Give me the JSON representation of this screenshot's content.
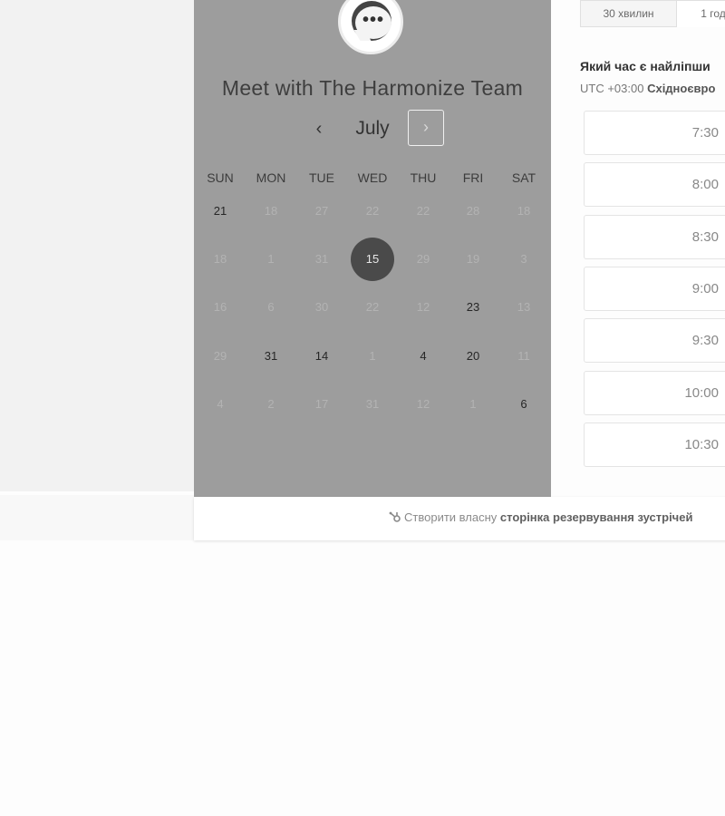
{
  "header": {
    "title": "Meet with The Harmonize Team",
    "avatar_icon": "chat-bubble-icon"
  },
  "calendar": {
    "month": "July",
    "prev_icon": "chevron-left-icon",
    "prev_glyph": "‹",
    "next_icon": "chevron-right-icon",
    "next_glyph": "›",
    "weekdays": [
      "SUN",
      "MON",
      "TUE",
      "WED",
      "THU",
      "FRI",
      "SAT"
    ],
    "weeks": [
      [
        {
          "d": "21",
          "s": "avail"
        },
        {
          "d": "18",
          "s": "dim"
        },
        {
          "d": "27",
          "s": "dim"
        },
        {
          "d": "22",
          "s": "dim"
        },
        {
          "d": "22",
          "s": "dim"
        },
        {
          "d": "28",
          "s": "dim"
        },
        {
          "d": "18",
          "s": "dim"
        }
      ],
      [
        {
          "d": "18",
          "s": "dim"
        },
        {
          "d": "1",
          "s": "dim"
        },
        {
          "d": "31",
          "s": "dim"
        },
        {
          "d": "15",
          "s": "sel"
        },
        {
          "d": "29",
          "s": "dim"
        },
        {
          "d": "19",
          "s": "dim"
        },
        {
          "d": "3",
          "s": "dim"
        }
      ],
      [
        {
          "d": "16",
          "s": "dim"
        },
        {
          "d": "6",
          "s": "dim"
        },
        {
          "d": "30",
          "s": "dim"
        },
        {
          "d": "22",
          "s": "dim"
        },
        {
          "d": "12",
          "s": "dim"
        },
        {
          "d": "23",
          "s": "avail"
        },
        {
          "d": "13",
          "s": "dim"
        }
      ],
      [
        {
          "d": "29",
          "s": "dim"
        },
        {
          "d": "31",
          "s": "avail"
        },
        {
          "d": "14",
          "s": "avail"
        },
        {
          "d": "1",
          "s": "dim"
        },
        {
          "d": "4",
          "s": "avail"
        },
        {
          "d": "20",
          "s": "avail"
        },
        {
          "d": "11",
          "s": "dim"
        }
      ],
      [
        {
          "d": "4",
          "s": "dim"
        },
        {
          "d": "2",
          "s": "dim"
        },
        {
          "d": "17",
          "s": "dim"
        },
        {
          "d": "31",
          "s": "dim"
        },
        {
          "d": "12",
          "s": "dim"
        },
        {
          "d": "1",
          "s": "dim"
        },
        {
          "d": "6",
          "s": "avail"
        }
      ]
    ]
  },
  "durations": [
    "30 хвилин",
    "1 год"
  ],
  "question": "Який час є найліпши",
  "timezone": {
    "offset": "UTC +03:00",
    "name": "Східноєвро"
  },
  "slots": [
    "7:30",
    "8:00",
    "8:30",
    "9:00",
    "9:30",
    "10:00",
    "10:30"
  ],
  "footer": {
    "icon": "hubspot-sprocket-icon",
    "text_plain": "Створити власну",
    "text_bold": "сторінка резервування зустрічей"
  },
  "colors": {
    "panel": "#9d9d9d",
    "selected_day": "#4a4a4a"
  }
}
